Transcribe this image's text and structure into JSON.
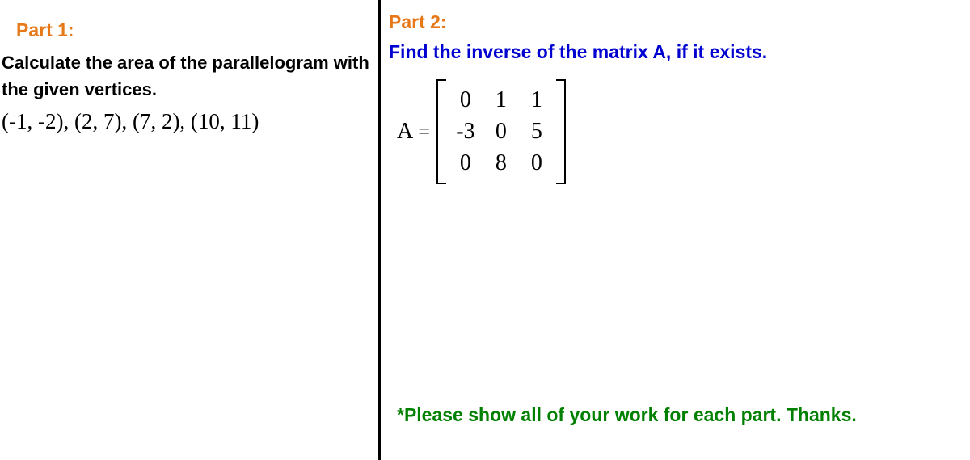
{
  "part1": {
    "heading": "Part 1:",
    "instruction": "Calculate the area of the parallelogram with the given vertices.",
    "vertices": "(-1, -2), (2, 7), (7, 2), (10, 11)"
  },
  "part2": {
    "heading": "Part 2:",
    "instruction": "Find the inverse of the matrix A, if it exists.",
    "matrix_label": "A",
    "equals": "=",
    "matrix": [
      [
        "0",
        "1",
        "1"
      ],
      [
        "-3",
        "0",
        "5"
      ],
      [
        "0",
        "8",
        "0"
      ]
    ],
    "note": "*Please show all of your work for each part. Thanks."
  }
}
